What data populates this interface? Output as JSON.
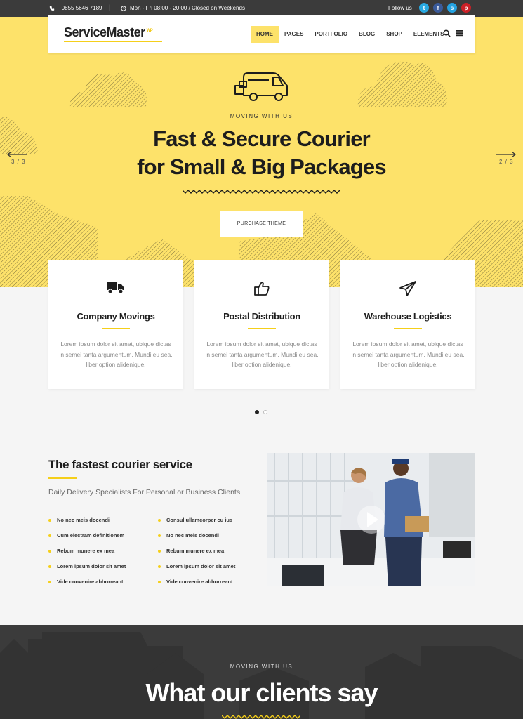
{
  "topbar": {
    "phone": "+0855 5646 7189",
    "hours": "Mon - Fri 08:00 - 20:00 / Closed on Weekends",
    "follow": "Follow us",
    "social": [
      {
        "icon": "twitter-icon",
        "glyph": "t",
        "color": "#29a9e1"
      },
      {
        "icon": "facebook-icon",
        "glyph": "f",
        "color": "#3b5b9a"
      },
      {
        "icon": "skype-icon",
        "glyph": "s",
        "color": "#24a2e0"
      },
      {
        "icon": "pinterest-icon",
        "glyph": "p",
        "color": "#cb2027"
      }
    ]
  },
  "header": {
    "logo": "ServiceMaster",
    "logo_badge": "WP",
    "nav": [
      "HOME",
      "PAGES",
      "PORTFOLIO",
      "BLOG",
      "SHOP",
      "ELEMENTS"
    ],
    "active": "HOME"
  },
  "hero": {
    "eyebrow": "MOVING WITH US",
    "title_line1": "Fast & Secure Courier",
    "title_line2": "for Small & Big Packages",
    "button": "PURCHASE THEME",
    "prev_counter": "3 / 3",
    "next_counter": "2 / 3",
    "accent": "#fde26a"
  },
  "services": [
    {
      "icon": "truck-icon",
      "title": "Company Movings",
      "text": "Lorem ipsum dolor sit amet, ubique dictas in semei tanta argumentum. Mundi eu sea, liber option alidenique."
    },
    {
      "icon": "thumbs-up-icon",
      "title": "Postal Distribution",
      "text": "Lorem ipsum dolor sit amet, ubique dictas in semei tanta argumentum. Mundi eu sea, liber option alidenique."
    },
    {
      "icon": "paper-plane-icon",
      "title": "Warehouse Logistics",
      "text": "Lorem ipsum dolor sit amet, ubique dictas in semei tanta argumentum. Mundi eu sea, liber option alidenique."
    }
  ],
  "about": {
    "title": "The fastest courier service",
    "subtitle": "Daily Delivery Specialists For Personal or Business Clients",
    "list_left": [
      "No nec meis docendi",
      "Cum electram definitionem",
      "Rebum munere ex mea",
      "Lorem ipsum dolor sit amet",
      "Vide convenire abhorreant"
    ],
    "list_right": [
      "Consul ullamcorper cu ius",
      "No nec meis docendi",
      "Rebum munere ex mea",
      "Lorem ipsum dolor sit amet",
      "Vide convenire abhorreant"
    ]
  },
  "testimonials": {
    "eyebrow": "MOVING WITH US",
    "title": "What our clients say"
  }
}
